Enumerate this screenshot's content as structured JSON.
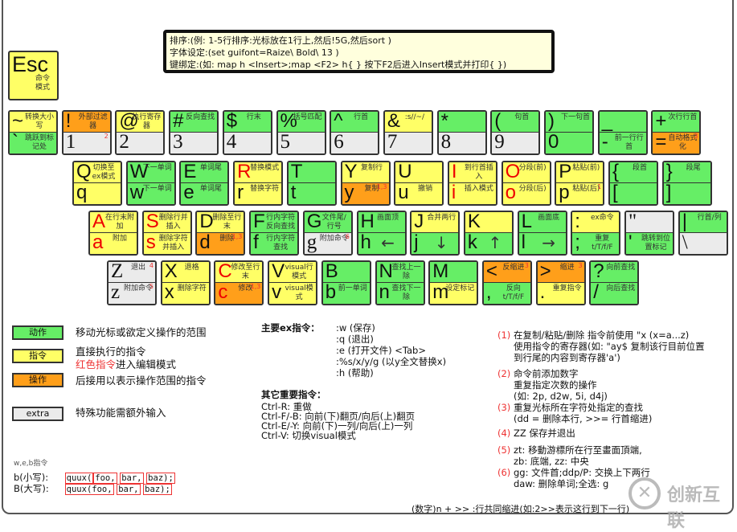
{
  "esc": {
    "key": "Esc",
    "label": "命令模式"
  },
  "tips": [
    "排序:(例: 1-5行排序:光标放在1行上,然后!5G,然后sort )",
    "字体设定:(set guifont=Raize\\ Bold\\ 13 )",
    "键绑定:(如: map h <Insert>;map <F2> h{ } 按下F2后进入Insert模式并打印{ })"
  ],
  "rows": [
    [
      {
        "t": {
          "k": "~",
          "l": "转换大小写",
          "c": "y"
        },
        "b": {
          "k": "`",
          "l": "跳跃到标记处",
          "c": "g"
        }
      },
      {
        "t": {
          "k": "!",
          "l": "外部过滤器",
          "c": "o"
        },
        "b": {
          "k": "1",
          "l": "",
          "c": "x",
          "n": "2"
        }
      },
      {
        "t": {
          "k": "@",
          "l": "执行寄存器",
          "c": "y"
        },
        "b": {
          "k": "2",
          "l": "",
          "c": "x"
        }
      },
      {
        "t": {
          "k": "#",
          "l": "反向查找",
          "c": "g"
        },
        "b": {
          "k": "3",
          "l": "",
          "c": "x"
        }
      },
      {
        "t": {
          "k": "$",
          "l": "行末",
          "c": "g"
        },
        "b": {
          "k": "4",
          "l": "",
          "c": "x"
        }
      },
      {
        "t": {
          "k": "%",
          "l": "括号匹配",
          "c": "g"
        },
        "b": {
          "k": "5",
          "l": "",
          "c": "x"
        }
      },
      {
        "t": {
          "k": "^",
          "l": "行首",
          "c": "g"
        },
        "b": {
          "k": "6",
          "l": "",
          "c": "x"
        }
      },
      {
        "t": {
          "k": "&",
          "l": ":s//~/",
          "c": "y"
        },
        "b": {
          "k": "7",
          "l": "",
          "c": "x"
        }
      },
      {
        "t": {
          "k": "*",
          "l": "",
          "c": "g"
        },
        "b": {
          "k": "8",
          "l": "",
          "c": "x"
        }
      },
      {
        "t": {
          "k": "(",
          "l": "句首",
          "c": "g"
        },
        "b": {
          "k": "9",
          "l": "",
          "c": "x"
        }
      },
      {
        "t": {
          "k": ")",
          "l": "下一句首",
          "c": "g"
        },
        "b": {
          "k": "0",
          "l": "",
          "c": "g"
        }
      },
      {
        "t": {
          "k": "_",
          "l": "",
          "c": "g"
        },
        "b": {
          "k": "-",
          "l": "前一行行首",
          "c": "g"
        }
      },
      {
        "t": {
          "k": "+",
          "l": "次行行首",
          "c": "g"
        },
        "b": {
          "k": "=",
          "l": "自动格式化",
          "c": "o",
          "n": "3"
        }
      }
    ],
    [
      {
        "t": {
          "k": "Q",
          "l": "切换至ex模式",
          "c": "y"
        },
        "b": {
          "k": "q",
          "l": "",
          "c": "y"
        }
      },
      {
        "t": {
          "k": "W",
          "l": "下一单词",
          "c": "g"
        },
        "b": {
          "k": "w",
          "l": "下一单词",
          "c": "g"
        }
      },
      {
        "t": {
          "k": "E",
          "l": "单词尾",
          "c": "g"
        },
        "b": {
          "k": "e",
          "l": "单词尾",
          "c": "g"
        }
      },
      {
        "t": {
          "k": "R",
          "l": "替换模式",
          "c": "y",
          "r": true
        },
        "b": {
          "k": "r",
          "l": "替换字符",
          "c": "y"
        }
      },
      {
        "t": {
          "k": "T",
          "l": "",
          "c": "g"
        },
        "b": {
          "k": "t",
          "l": "",
          "c": "g"
        }
      },
      {
        "t": {
          "k": "Y",
          "l": "复制行",
          "c": "y"
        },
        "b": {
          "k": "y",
          "l": "复制",
          "c": "o",
          "n": "1,3"
        }
      },
      {
        "t": {
          "k": "U",
          "l": "",
          "c": "y"
        },
        "b": {
          "k": "u",
          "l": "撤销",
          "c": "y"
        }
      },
      {
        "t": {
          "k": "I",
          "l": "到行首插入",
          "c": "y",
          "r": true
        },
        "b": {
          "k": "i",
          "l": "插入模式",
          "c": "y",
          "r": true
        }
      },
      {
        "t": {
          "k": "O",
          "l": "分段(前)",
          "c": "y",
          "r": true
        },
        "b": {
          "k": "o",
          "l": "分段(后)",
          "c": "y",
          "r": true
        }
      },
      {
        "t": {
          "k": "P",
          "l": "粘贴(前)",
          "c": "y"
        },
        "b": {
          "k": "p",
          "l": "粘贴(后)",
          "c": "y",
          "n": "1"
        }
      },
      {
        "t": {
          "k": "{",
          "l": "段首",
          "c": "g"
        },
        "b": {
          "k": "[",
          "l": "",
          "c": "g"
        }
      },
      {
        "t": {
          "k": "}",
          "l": "段尾",
          "c": "g"
        },
        "b": {
          "k": "]",
          "l": "",
          "c": "g"
        }
      }
    ],
    [
      {
        "t": {
          "k": "A",
          "l": "在行末附加",
          "c": "y",
          "r": true
        },
        "b": {
          "k": "a",
          "l": "附加",
          "c": "y",
          "r": true
        }
      },
      {
        "t": {
          "k": "S",
          "l": "删除行并插入",
          "c": "y",
          "r": true
        },
        "b": {
          "k": "s",
          "l": "删除字符并插入",
          "c": "y",
          "r": true
        }
      },
      {
        "t": {
          "k": "D",
          "l": "删除至行末",
          "c": "y"
        },
        "b": {
          "k": "d",
          "l": "删除",
          "c": "o",
          "n": "1,3"
        }
      },
      {
        "t": {
          "k": "F",
          "l": "行内字符反向查找",
          "c": "g"
        },
        "b": {
          "k": "f",
          "l": "行内字符查找",
          "c": "g"
        }
      },
      {
        "t": {
          "k": "G",
          "l": "文件尾/行号",
          "c": "g"
        },
        "b": {
          "k": "g",
          "l": "附加命令",
          "c": "x",
          "n": "6"
        }
      },
      {
        "t": {
          "k": "H",
          "l": "画面顶",
          "c": "g"
        },
        "b": {
          "k": "h",
          "l": "←",
          "c": "g"
        }
      },
      {
        "t": {
          "k": "J",
          "l": "合并两行",
          "c": "y"
        },
        "b": {
          "k": "j",
          "l": "↓",
          "c": "g"
        }
      },
      {
        "t": {
          "k": "K",
          "l": "",
          "c": "y"
        },
        "b": {
          "k": "k",
          "l": "↑",
          "c": "g"
        }
      },
      {
        "t": {
          "k": "L",
          "l": "画面底",
          "c": "g"
        },
        "b": {
          "k": "l",
          "l": "→",
          "c": "g"
        }
      },
      {
        "t": {
          "k": ":",
          "l": "ex命令",
          "c": "y"
        },
        "b": {
          "k": ";",
          "l": "重复t/T/f/F",
          "c": "g"
        }
      },
      {
        "t": {
          "k": "\"",
          "l": "",
          "c": "x"
        },
        "b": {
          "k": "'",
          "l": "跳转到位置标记",
          "c": "g"
        }
      },
      {
        "t": {
          "k": "|",
          "l": "行首/列",
          "c": "g"
        },
        "b": {
          "k": "\\",
          "l": "",
          "c": "x"
        }
      }
    ],
    [
      {
        "t": {
          "k": "Z",
          "l": "退出",
          "c": "x",
          "n": "4"
        },
        "b": {
          "k": "z",
          "l": "附加命令",
          "c": "x",
          "n": "5"
        }
      },
      {
        "t": {
          "k": "X",
          "l": "退格",
          "c": "y"
        },
        "b": {
          "k": "x",
          "l": "删除字符",
          "c": "y"
        }
      },
      {
        "t": {
          "k": "C",
          "l": "修改至行末",
          "c": "y",
          "r": true
        },
        "b": {
          "k": "c",
          "l": "修改",
          "c": "o",
          "r": true,
          "n": "1,3"
        }
      },
      {
        "t": {
          "k": "V",
          "l": "visual行模式",
          "c": "y"
        },
        "b": {
          "k": "v",
          "l": "visual模式",
          "c": "y"
        }
      },
      {
        "t": {
          "k": "B",
          "l": "",
          "c": "g"
        },
        "b": {
          "k": "b",
          "l": "前一单词",
          "c": "g"
        }
      },
      {
        "t": {
          "k": "N",
          "l": "查找上一除",
          "c": "g"
        },
        "b": {
          "k": "n",
          "l": "查找下一除",
          "c": "g"
        }
      },
      {
        "t": {
          "k": "M",
          "l": "",
          "c": "g"
        },
        "b": {
          "k": "m",
          "l": "设定标记",
          "c": "y"
        }
      },
      {
        "t": {
          "k": "<",
          "l": "反缩进",
          "c": "o",
          "n": "3"
        },
        "b": {
          "k": ",",
          "l": "反向t/T/f/F",
          "c": "g"
        }
      },
      {
        "t": {
          "k": ">",
          "l": "缩进",
          "c": "o",
          "n": "3"
        },
        "b": {
          "k": ".",
          "l": "重复指令",
          "c": "y"
        }
      },
      {
        "t": {
          "k": "?",
          "l": "向前查找",
          "c": "g"
        },
        "b": {
          "k": "/",
          "l": "向后查找",
          "c": "g"
        }
      }
    ]
  ],
  "legend": [
    {
      "box": "动作",
      "desc": "移动光标或欲定义操作的范围",
      "c": "#66ee66"
    },
    {
      "box": "指令",
      "desc": "直接执行的指令",
      "desc_red": "红色指令",
      "desc_rest": "进入编辑模式",
      "c": "#ffff66"
    },
    {
      "box": "操作",
      "desc": "后接用以表示操作范围的指令",
      "c": "#ff9f1a"
    },
    {
      "box": "extra",
      "desc": "特殊功能需额外输入",
      "c": "#ebebeb"
    }
  ],
  "ex": {
    "title": "主要ex指令：",
    "items": [
      ":w (保存)",
      ":q (退出)",
      ":e (打开文件) <Tab>",
      ":%s/x/y/g (以y全文替换x)",
      ":h (帮助)"
    ]
  },
  "other": {
    "title": "其它重要指令：",
    "items": [
      "Ctrl-R: 重做",
      "Ctrl-F/-B: 向前(下)翻页/向后(上)翻页",
      "Ctrl-E/-Y: 向前(下)一列/向后(上)一列",
      "Ctrl-V: 切换visual模式"
    ]
  },
  "notes": [
    {
      "n": "(1)",
      "lines": [
        "在复制/粘贴/删除 指令前使用 \"x (x=a...z)",
        "使用指令的寄存器(如: \"ay$ 复制该行目前位置",
        "到行尾的内容到寄存器'a')"
      ]
    },
    {
      "n": "(2)",
      "lines": [
        "命令前添加数字",
        "重复指定次数的操作",
        "(如: 2p, d2w, 5i, d4j)"
      ]
    },
    {
      "n": "(3)",
      "lines": [
        "重复光标所在字符处指定的查找",
        "(dd = 删除本行, >>= 行首缩进)"
      ]
    },
    {
      "n": "(4)",
      "lines": [
        "ZZ 保存并退出"
      ]
    },
    {
      "n": "(5)",
      "lines": [
        "zt: 移動游標所在行至畫面頂端,",
        "zb: 底端, zz: 中央"
      ]
    },
    {
      "n": "(6)",
      "lines": [
        "gg: 文件首;ddp/P: 交换上下两行",
        "daw: 删除单词;全选: g"
      ]
    }
  ],
  "web": {
    "title": "w,e,b指令",
    "b_label": "b(小写):",
    "B_label": "B(大写):",
    "b_parts": [
      "quux(",
      "foo,",
      "bar,",
      "baz);"
    ],
    "B_parts": [
      "quux(foo,",
      "bar,",
      "baz);"
    ]
  },
  "bottom_note": "(数字)n + >> :行共同缩进(如:2>>表示这行到下一行)",
  "watermark": "创新互联"
}
